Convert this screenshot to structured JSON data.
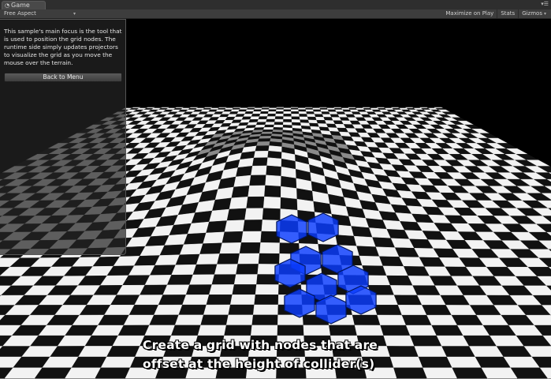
{
  "window": {
    "tab_label": "Game",
    "tab_icon": "game-view-icon",
    "menu_icon": "panel-menu-icon"
  },
  "toolbar": {
    "aspect_value": "Free Aspect",
    "maximize_label": "Maximize on Play",
    "stats_label": "Stats",
    "gizmos_label": "Gizmos"
  },
  "panel": {
    "description": "This sample's main focus is the tool that is used to position the grid nodes. The runtime side simply updates projectors to visualize the grid as you move the mouse over the terrain.",
    "back_button": "Back to Menu"
  },
  "caption": {
    "line1": "Create a grid with nodes that are",
    "line2": "offset at the height of collider(s)"
  },
  "colors": {
    "hex_fill": "#0a3cff",
    "hex_dark": "#00145a",
    "checker_light": "#f2f2f2",
    "checker_dark": "#111111"
  }
}
